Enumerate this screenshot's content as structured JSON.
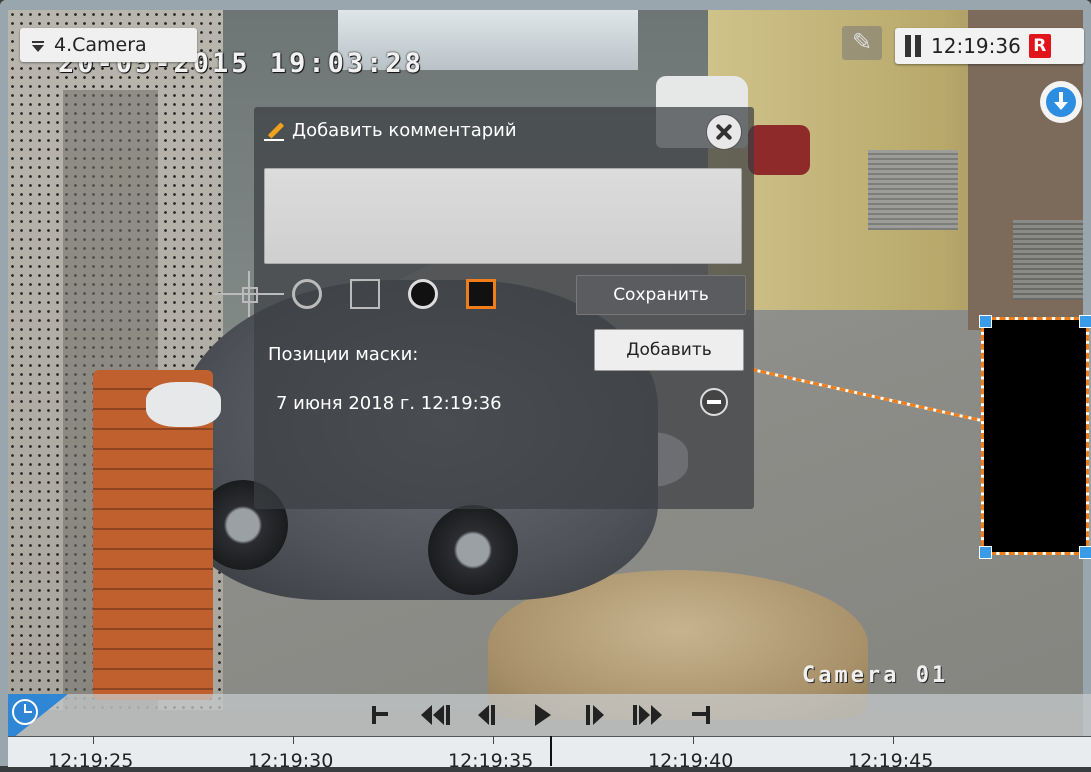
{
  "camera": {
    "selector_label": "4.Camera",
    "osd_datetime": "20-05-2015 19:03:28",
    "osd_name": "Camera 01"
  },
  "status": {
    "time": "12:19:36",
    "rec_badge": "R",
    "rec_color": "#e0141a"
  },
  "icons": {
    "selector": "triangle-down-icon",
    "comment": "comment-pencil-icon",
    "pause": "pause-icon",
    "download": "download-arrow-icon",
    "clock": "clock-icon"
  },
  "dialog": {
    "title": "Добавить комментарий",
    "comment_value": "",
    "save_label": "Сохранить",
    "add_label": "Добавить",
    "mask_positions_label": "Позиции маски:",
    "mask_entries": [
      "7 июня 2018 г. 12:19:36"
    ],
    "tools": [
      "move-tool",
      "ellipse-tool",
      "rectangle-tool",
      "filled-circle-tool",
      "filled-square-tool"
    ],
    "selected_tool": "filled-square-tool"
  },
  "colors": {
    "accent": "#ef7d1a",
    "handle": "#3a9be8",
    "clock_corner": "#2e86d4"
  },
  "playback": {
    "controls": [
      "go-to-start",
      "fast-backward",
      "step-backward",
      "play",
      "step-forward",
      "fast-forward",
      "go-to-end"
    ]
  },
  "timeline": {
    "ticks": [
      "12:19:25",
      "12:19:30",
      "12:19:35",
      "12:19:40",
      "12:19:45"
    ]
  }
}
